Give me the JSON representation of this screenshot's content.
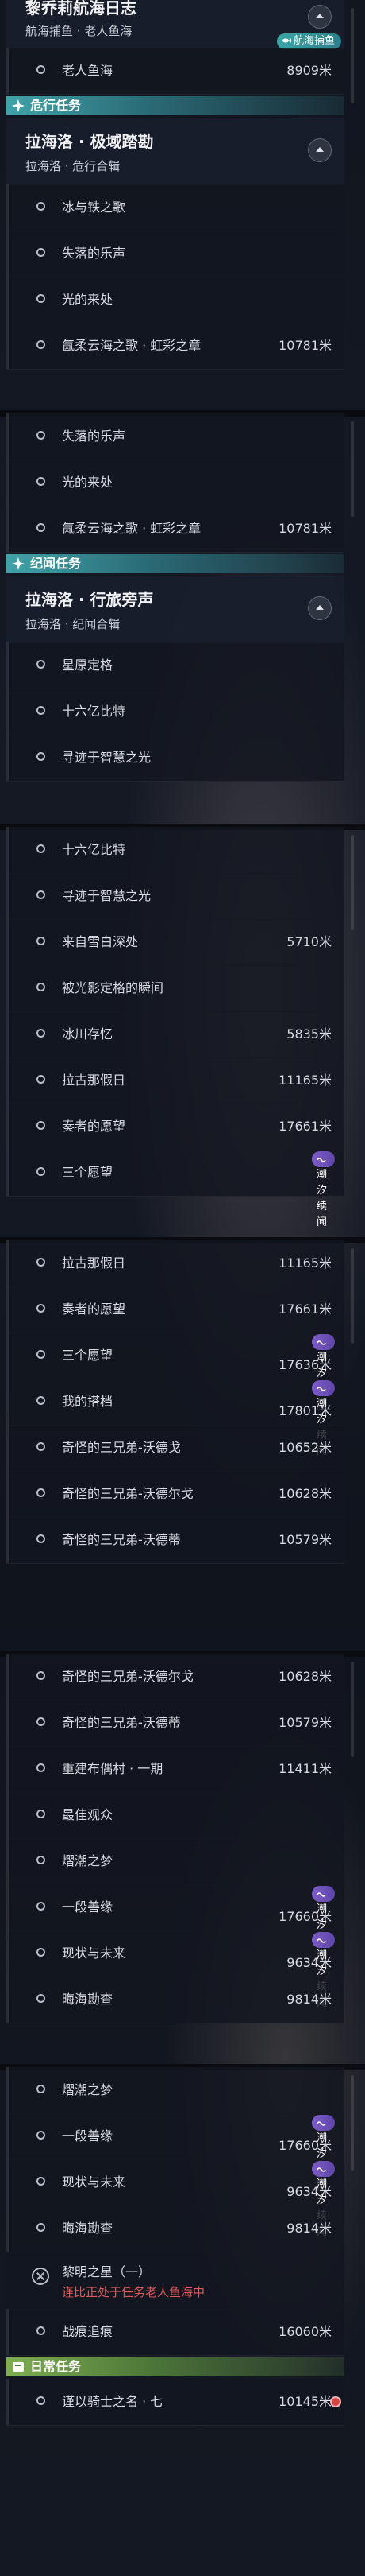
{
  "panels": [
    {
      "top": [
        {
          "kind": "group",
          "title": "黎乔莉航海日志",
          "sub": "航海捕鱼 · 老人鱼海",
          "y": -30,
          "badge": {
            "text": "航海捕鱼",
            "style": "teal"
          }
        },
        {
          "kind": "row",
          "name": "老人鱼海",
          "dist": "8909米"
        },
        {
          "kind": "sec",
          "label": "危行任务"
        },
        {
          "kind": "group",
          "title": "拉海洛 · 极域踏勘",
          "sub": "拉海洛 · 危行合辑"
        },
        {
          "kind": "row",
          "name": "冰与铁之歌"
        },
        {
          "kind": "row",
          "name": "失落的乐声"
        },
        {
          "kind": "row",
          "name": "光的来处"
        },
        {
          "kind": "row",
          "name": "氤柔云海之歌 · 虹彩之章",
          "dist": "10781米"
        }
      ]
    }
  ],
  "screens": [
    {
      "items": [
        {
          "t": "group",
          "title": "黎乔莉航海日志",
          "sub": "航海捕鱼 · 老人鱼海",
          "badge": "航海捕鱼",
          "badgeStyle": "teal",
          "h": 60
        },
        {
          "t": "row",
          "name": "老人鱼海",
          "dist": "8909米"
        },
        {
          "t": "sec",
          "label": "危行任务"
        },
        {
          "t": "group",
          "title": "拉海洛 · 极域踏勘",
          "sub": "拉海洛 · 危行合辑"
        },
        {
          "t": "row",
          "name": "冰与铁之歌"
        },
        {
          "t": "row",
          "name": "失落的乐声"
        },
        {
          "t": "row",
          "name": "光的来处"
        },
        {
          "t": "row",
          "name": "氤柔云海之歌 · 虹彩之章",
          "dist": "10781米"
        }
      ]
    },
    {
      "items": [
        {
          "t": "row",
          "name": "失落的乐声"
        },
        {
          "t": "row",
          "name": "光的来处"
        },
        {
          "t": "row",
          "name": "氤柔云海之歌 · 虹彩之章",
          "dist": "10781米"
        },
        {
          "t": "sec",
          "label": "纪闻任务"
        },
        {
          "t": "group",
          "title": "拉海洛 · 行旅旁声",
          "sub": "拉海洛 · 纪闻合辑"
        },
        {
          "t": "row",
          "name": "星原定格"
        },
        {
          "t": "row",
          "name": "十六亿比特"
        },
        {
          "t": "row",
          "name": "寻迹于智慧之光"
        }
      ]
    },
    {
      "items": [
        {
          "t": "row",
          "name": "十六亿比特"
        },
        {
          "t": "row",
          "name": "寻迹于智慧之光"
        },
        {
          "t": "row",
          "name": "来自雪白深处",
          "dist": "5710米"
        },
        {
          "t": "row",
          "name": "被光影定格的瞬间"
        },
        {
          "t": "row",
          "name": "冰川存忆",
          "dist": "5835米"
        },
        {
          "t": "row",
          "name": "拉古那假日",
          "dist": "11165米"
        },
        {
          "t": "row",
          "name": "奏者的愿望",
          "dist": "17661米"
        },
        {
          "t": "row",
          "name": "三个愿望",
          "badge": "潮汐续闻"
        }
      ]
    },
    {
      "items": [
        {
          "t": "row",
          "name": "拉古那假日",
          "dist": "11165米"
        },
        {
          "t": "row",
          "name": "奏者的愿望",
          "dist": "17661米"
        },
        {
          "t": "row",
          "name": "三个愿望",
          "dist": "17636米",
          "badge": "潮汐续闻"
        },
        {
          "t": "row",
          "name": "我的搭档",
          "dist": "17801米",
          "badge": "潮汐续闻"
        },
        {
          "t": "row",
          "name": "奇怪的三兄弟-沃德戈",
          "dist": "10652米"
        },
        {
          "t": "row",
          "name": "奇怪的三兄弟-沃德尔戈",
          "dist": "10628米"
        },
        {
          "t": "row",
          "name": "奇怪的三兄弟-沃德蒂",
          "dist": "10579米"
        }
      ]
    },
    {
      "items": [
        {
          "t": "row",
          "name": "奇怪的三兄弟-沃德尔戈",
          "dist": "10628米"
        },
        {
          "t": "row",
          "name": "奇怪的三兄弟-沃德蒂",
          "dist": "10579米"
        },
        {
          "t": "row",
          "name": "重建布偶村 · 一期",
          "dist": "11411米"
        },
        {
          "t": "row",
          "name": "最佳观众"
        },
        {
          "t": "row",
          "name": "熠潮之梦"
        },
        {
          "t": "row",
          "name": "一段善缘",
          "dist": "17660米",
          "badge": "潮汐续闻"
        },
        {
          "t": "row",
          "name": "现状与未来",
          "dist": "9634米",
          "badge": "潮汐续闻"
        },
        {
          "t": "row",
          "name": "晦海勘查",
          "dist": "9814米"
        }
      ]
    },
    {
      "items": [
        {
          "t": "row",
          "name": "熠潮之梦"
        },
        {
          "t": "row",
          "name": "一段善缘",
          "dist": "17660米",
          "badge": "潮汐续闻"
        },
        {
          "t": "row",
          "name": "现状与未来",
          "dist": "9634米",
          "badge": "潮汐续闻"
        },
        {
          "t": "row",
          "name": "晦海勘查",
          "dist": "9814米"
        },
        {
          "t": "warn",
          "name": "黎明之星（一）",
          "red": "谨比正处于任务老人鱼海中"
        },
        {
          "t": "row",
          "name": "战痕追痕",
          "dist": "16060米"
        },
        {
          "t": "sec",
          "label": "日常任务",
          "green": true
        },
        {
          "t": "row",
          "name": "谨以骑士之名 · 七",
          "dist": "10145米",
          "pin": true
        }
      ]
    }
  ]
}
